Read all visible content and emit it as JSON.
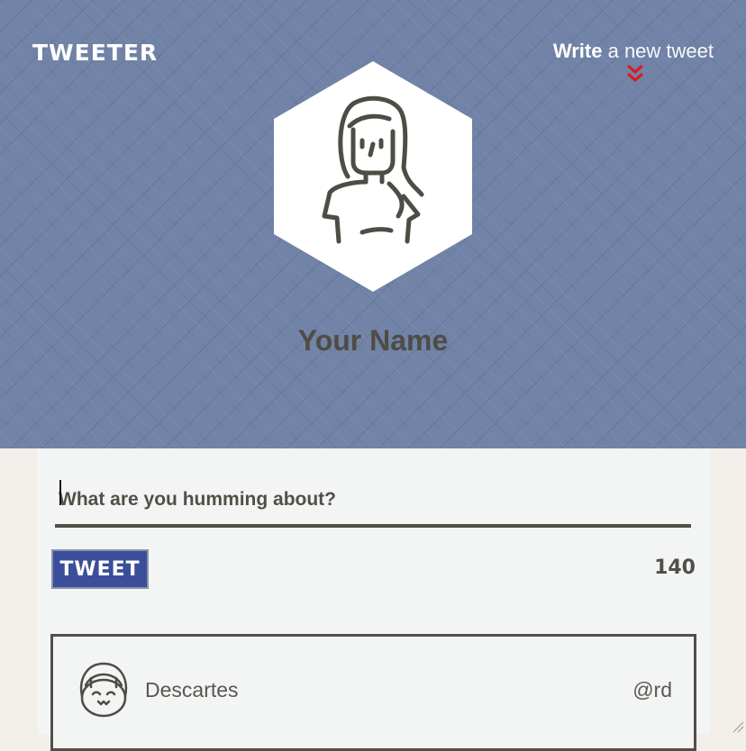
{
  "header": {
    "logo": "TWEETER",
    "write_link": {
      "strong": "Write",
      "light": "a new tweet"
    },
    "profile_name": "Your Name"
  },
  "composer": {
    "placeholder": "What are you humming about?",
    "button_label": "TWEET",
    "char_count": "140"
  },
  "tweets": [
    {
      "name": "Descartes",
      "handle": "@rd"
    }
  ],
  "colors": {
    "hero_bg": "#7183a6",
    "button_bg": "#3b4e9c",
    "chevron": "#e4151c",
    "text_dark": "#524f48"
  },
  "icons": {
    "chevron": "double-chevron-down-icon",
    "profile_avatar": "woman-avatar-icon",
    "tweet_avatar": "smiling-face-avatar-icon"
  }
}
